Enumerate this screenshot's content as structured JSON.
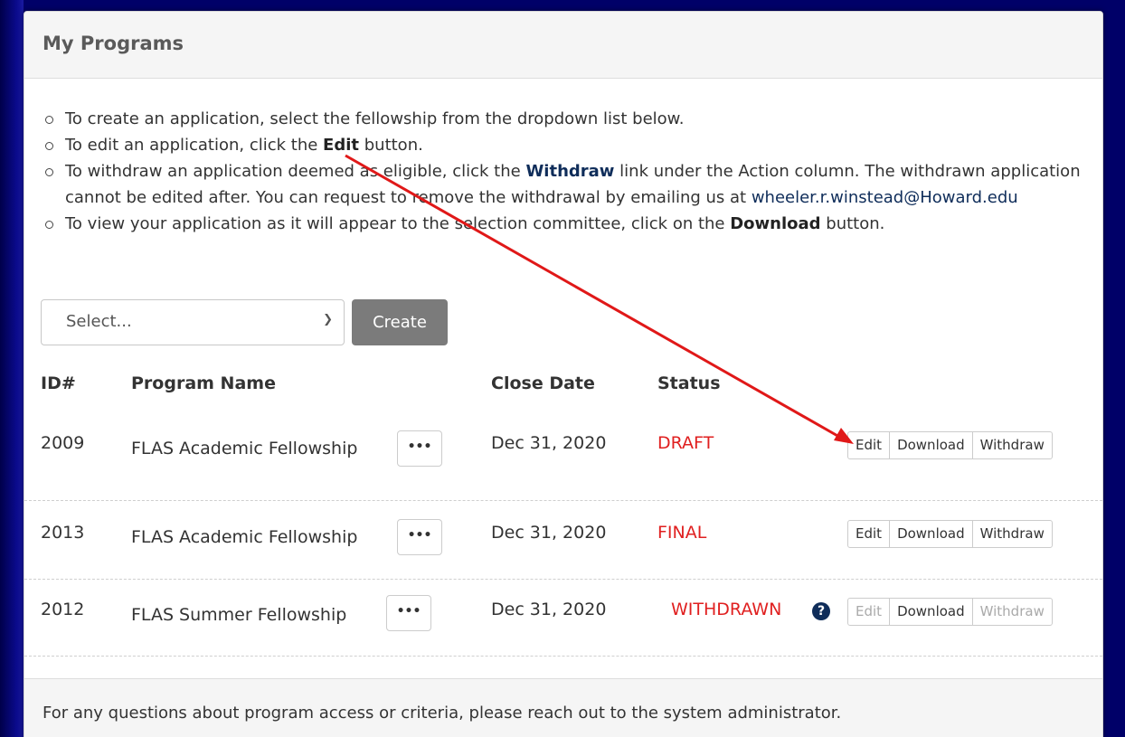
{
  "panel": {
    "title": "My Programs"
  },
  "instructions": {
    "i1": "To create an application, select the fellowship from the dropdown list below.",
    "i2_pre": "To edit an application, click the ",
    "i2_bold": "Edit",
    "i2_post": " button.",
    "i3_pre": "To withdraw an application deemed as eligible, click the ",
    "i3_bold": "Withdraw",
    "i3_post": " link under the Action column. The withdrawn application cannot be edited after. You can request to remove the withdrawal by emailing us at ",
    "i3_email": "wheeler.r.winstead@Howard.edu",
    "i4_pre": "To view your application as it will appear to the selection committee, click on the ",
    "i4_bold": "Download",
    "i4_post": " button."
  },
  "form": {
    "select_value": "Select...",
    "create_label": "Create"
  },
  "table": {
    "headers": {
      "id": "ID#",
      "program": "Program Name",
      "close": "Close Date",
      "status": "Status"
    },
    "rows": [
      {
        "id": "2009",
        "program": "FLAS Academic Fellowship",
        "close": "Dec 31, 2020",
        "status": "DRAFT",
        "more": "•••",
        "edit": "Edit",
        "download": "Download",
        "withdraw": "Withdraw"
      },
      {
        "id": "2013",
        "program": "FLAS Academic Fellowship",
        "close": "Dec 31, 2020",
        "status": "FINAL",
        "more": "•••",
        "edit": "Edit",
        "download": "Download",
        "withdraw": "Withdraw"
      },
      {
        "id": "2012",
        "program": "FLAS Summer Fellowship",
        "close": "Dec 31, 2020",
        "status": "WITHDRAWN",
        "help": "?",
        "more": "•••",
        "edit": "Edit",
        "download": "Download",
        "withdraw": "Withdraw"
      }
    ]
  },
  "footer": {
    "text": "For any questions about program access or criteria, please reach out to the system administrator."
  },
  "colors": {
    "background": "#000068",
    "status_red": "#e02020",
    "link_navy": "#0f2d5a",
    "arrow": "#e01818"
  },
  "icons": {
    "dropdown": "chevron-down-icon",
    "help": "question-circle-icon",
    "more": "ellipsis-icon",
    "bullet": "circle-bullet-icon"
  }
}
